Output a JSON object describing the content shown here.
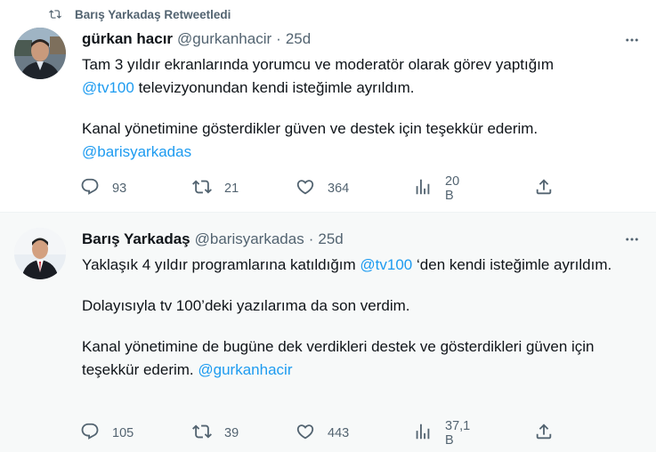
{
  "colors": {
    "link": "#1d9bf0",
    "muted": "#536471",
    "text": "#0f1419"
  },
  "tweet1": {
    "retweet_label": "Barış Yarkadaş Retweetledi",
    "name": "gürkan hacır",
    "handle": "@gurkanhacir",
    "separator": "·",
    "time": "25d",
    "line1": "Tam 3 yıldır ekranlarında yorumcu ve moderatör olarak görev yaptığım",
    "mention_tv100": "@tv100",
    "line2_rest": " televizyonundan kendi isteğimle ayrıldım.",
    "para2": "Kanal yönetimine gösterdikler güven ve destek için teşekkür ederim.",
    "mention_barisyarkadas": "@barisyarkadas",
    "replies": "93",
    "retweets": "21",
    "likes": "364",
    "views": "20 B",
    "icons": [
      "retweet-icon",
      "more-icon",
      "reply-icon",
      "retweet-icon",
      "like-icon",
      "views-icon",
      "share-icon"
    ]
  },
  "tweet2": {
    "name": "Barış Yarkadaş",
    "handle": "@barisyarkadas",
    "separator": "·",
    "time": "25d",
    "line1_start": "Yaklaşık 4 yıldır programlarına katıldığım ",
    "mention_tv100": "@tv100",
    "line1_end": " ‘den kendi isteğimle ayrıldım.",
    "para2": "Dolayısıyla tv 100’deki yazılarıma da son verdim.",
    "para3": "Kanal yönetimine de bugüne dek verdikleri destek ve gösterdikleri güven için teşekkür ederim. ",
    "mention_gurkanhacir": "@gurkanhacir",
    "replies": "105",
    "retweets": "39",
    "likes": "443",
    "views": "37,1 B"
  }
}
